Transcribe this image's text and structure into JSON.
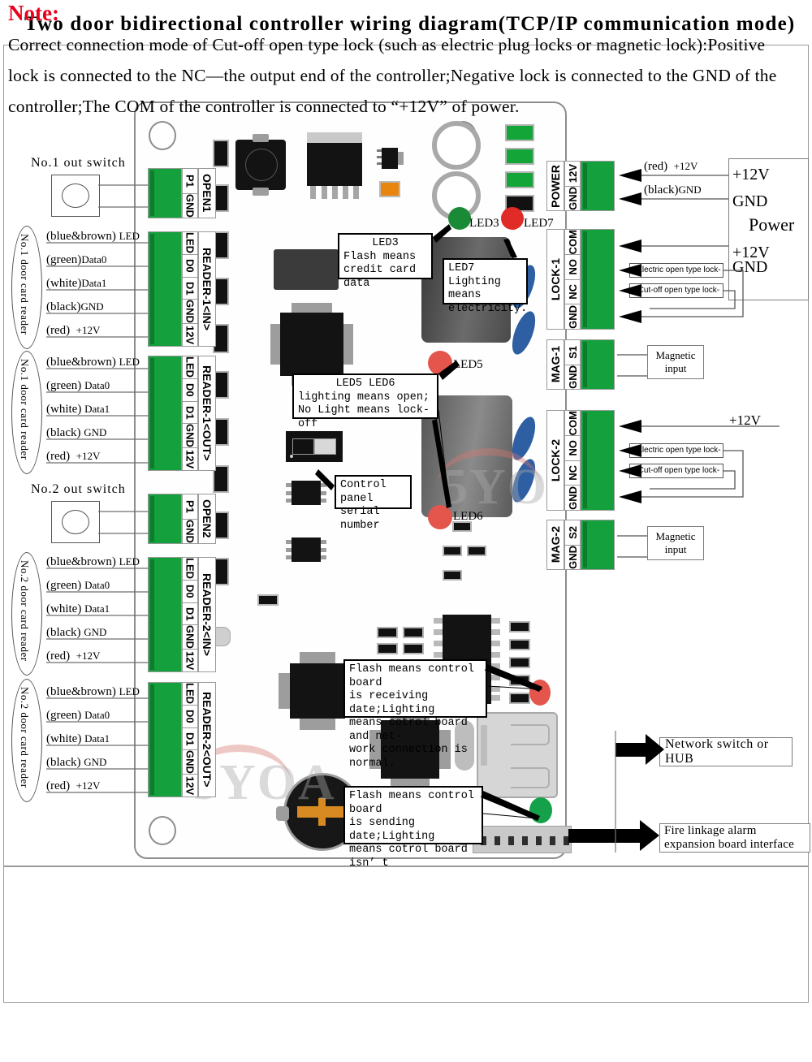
{
  "title": "Two door bidirectional controller wiring diagram(TCP/IP communication mode)",
  "note": {
    "label": "Note:",
    "text": "Correct connection mode of Cut-off open type lock (such as electric plug locks or magnetic lock):Positive lock is connected to the NC—the output end of the controller;Negative lock is connected to the GND of the controller;The COM of the controller is connected to “+12V” of power."
  },
  "watermark": "5YOA",
  "left": {
    "out_switch_1": "No.1 out switch",
    "out_switch_2": "No.2 out switch",
    "reader_group_1": "No.1 door card reader",
    "reader_group_2": "No.2 door card reader",
    "wire_labels": [
      {
        "color": "(blue&brown)",
        "signal": "LED"
      },
      {
        "color": "(green)",
        "signal": "Data0"
      },
      {
        "color": "(white)",
        "signal": "Data1"
      },
      {
        "color": "(black)",
        "signal": "GND"
      },
      {
        "color": "(red)",
        "signal": "+12V"
      }
    ]
  },
  "terminals": {
    "open1": {
      "name": "OPEN1",
      "pins": [
        "P1",
        "GND"
      ]
    },
    "reader1in": {
      "name": "READER-1<IN>",
      "pins": [
        "LED",
        "D0",
        "D1",
        "GND",
        "12V"
      ]
    },
    "reader1out": {
      "name": "READER-1<OUT>",
      "pins": [
        "LED",
        "D0",
        "D1",
        "GND",
        "12V"
      ]
    },
    "open2": {
      "name": "OPEN2",
      "pins": [
        "P1",
        "GND"
      ]
    },
    "reader2in": {
      "name": "READER-2<IN>",
      "pins": [
        "LED",
        "D0",
        "D1",
        "GND",
        "12V"
      ]
    },
    "reader2out": {
      "name": "READER-2<OUT>",
      "pins": [
        "LED",
        "D0",
        "D1",
        "GND",
        "12V"
      ]
    },
    "power": {
      "name": "POWER",
      "pins": [
        "12V",
        "GND"
      ]
    },
    "lock1": {
      "name": "LOCK-1",
      "pins": [
        "COM",
        "NO",
        "NC",
        "GND"
      ]
    },
    "mag1": {
      "name": "MAG-1",
      "pins": [
        "S1",
        "GND"
      ]
    },
    "lock2": {
      "name": "LOCK-2",
      "pins": [
        "COM",
        "NO",
        "NC",
        "GND"
      ]
    },
    "mag2": {
      "name": "MAG-2",
      "pins": [
        "S2",
        "GND"
      ]
    }
  },
  "right": {
    "power_red": {
      "color": "(red)",
      "signal": "+12V"
    },
    "power_black": {
      "color": "(black)",
      "signal": "GND"
    },
    "power_box": {
      "p12v": "+12V",
      "gnd": "GND",
      "title": "Power",
      "p12v2": "+12V",
      "gnd2": "GND"
    },
    "lock2_12v": "+12V",
    "electric_lock_label": "Electric open type lock",
    "cutoff_lock_label": "Cut-off open type lock",
    "plus": "+",
    "minus": "-",
    "magnetic_input_1": "Magnetic input",
    "magnetic_input_2": "Magnetic input",
    "network_switch": "Network switch or HUB",
    "fire_linkage": "Fire linkage alarm expansion board interface"
  },
  "callouts": {
    "led3": {
      "title": "LED3",
      "text": "Flash means\ncredit card data"
    },
    "led7": {
      "title": "LED7",
      "text": "Lighting means\nelectricity."
    },
    "led56": {
      "title": "LED5 LED6",
      "text": "lighting means open;\nNo Light means lock-off"
    },
    "serial": {
      "text": "Control panel\nserial number"
    },
    "net_recv": {
      "text": "Flash means control board\nis receiving date;Lighting\nmeans cotrol board and net-\nwork connection is normal."
    },
    "net_send": {
      "text": "Flash means control board\nis sending date;Lighting\nmeans cotrol board isn’ t\nsend date."
    }
  },
  "leds": {
    "led3": {
      "label": "LED3",
      "color": "#1b8a37"
    },
    "led7": {
      "label": "LED7",
      "color": "#e02b26"
    },
    "led5": {
      "label": "LED5",
      "color": "#e4554c"
    },
    "led6": {
      "label": "LED6",
      "color": "#e4554c"
    },
    "net_recv": {
      "color": "#e4554c"
    },
    "net_send": {
      "color": "#15a04a"
    }
  }
}
